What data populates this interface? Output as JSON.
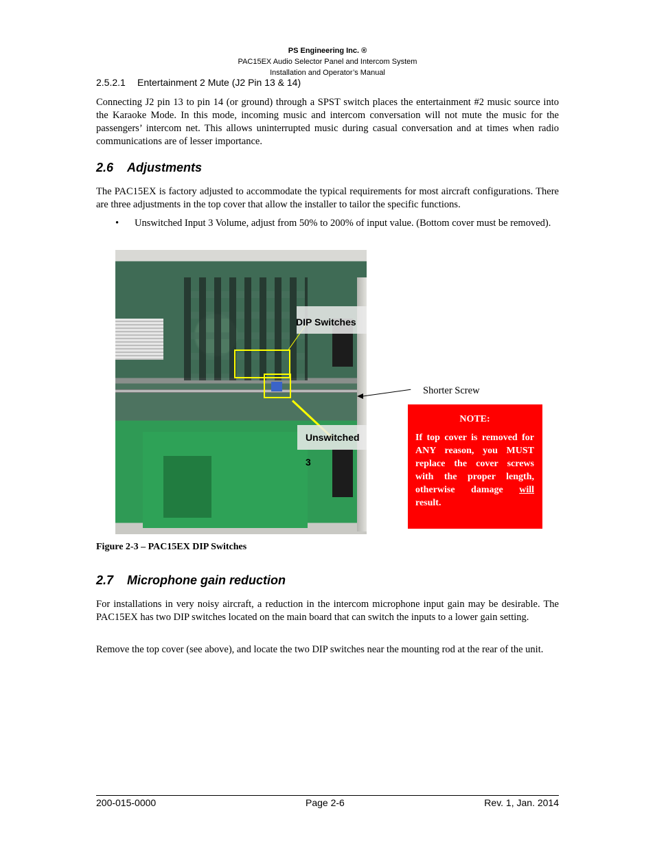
{
  "header": {
    "company": "PS Engineering Inc. ®",
    "product": "PAC15EX Audio Selector Panel and Intercom System",
    "manual": "Installation and Operator’s Manual"
  },
  "section_2_5_2_1": {
    "number": "2.5.2.1",
    "title": "Entertainment 2 Mute (J2 Pin 13 & 14)",
    "body": "Connecting J2 pin 13 to pin 14 (or ground) through a SPST switch places the entertainment #2 music source into the Karaoke Mode. In this mode, incoming music and intercom conversation will not mute the music for the passengers’ intercom net. This allows uninterrupted music during casual conversation and at times when radio communications are of lesser importance."
  },
  "section_2_6": {
    "number": "2.6",
    "title": "Adjustments",
    "body": "The PAC15EX is factory adjusted to accommodate the typical requirements for most aircraft configurations. There are three adjustments in the top cover that allow the installer to tailor the specific functions.",
    "bullets": [
      "Unswitched Input 3 Volume, adjust from 50% to 200% of input value. (Bottom cover must be removed)."
    ]
  },
  "figure": {
    "callout_dip": "DIP Switches",
    "callout_unswitched": "Unswitched 3",
    "screw_label": "Shorter Screw",
    "caption": "Figure 2-3 – PAC15EX DIP Switches",
    "highlight_color": "#ffff00"
  },
  "note": {
    "title": "NOTE:",
    "body_before": "If top cover is removed for ANY reason, you MUST replace the cover screws with the proper length, otherwise damage ",
    "underlined": "will",
    "body_after": " result.",
    "background": "#ff0000"
  },
  "section_2_7": {
    "number": "2.7",
    "title": "Microphone gain reduction",
    "paragraphs": [
      "For installations in very noisy aircraft, a reduction in the intercom microphone input gain may be desirable. The PAC15EX has two DIP switches located on the main board that can switch the inputs to a lower gain setting.",
      "Remove the top cover (see above), and locate the two DIP switches near the mounting rod at the rear of the unit."
    ]
  },
  "footer": {
    "doc_number": "200-015-0000",
    "page": "Page 2-6",
    "revision": "Rev. 1, Jan. 2014"
  }
}
